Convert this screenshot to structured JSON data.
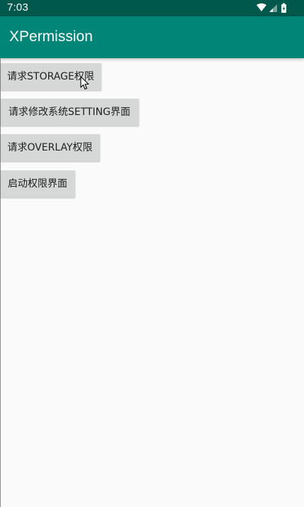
{
  "status_bar": {
    "time": "7:03",
    "icons": [
      "wifi-icon",
      "signal-icon",
      "battery-icon"
    ]
  },
  "app_bar": {
    "title": "XPermission"
  },
  "buttons": [
    {
      "label": "请求STORAGE权限"
    },
    {
      "label": "请求修改系统SETTING界面"
    },
    {
      "label": "请求OVERLAY权限"
    },
    {
      "label": "启动权限界面"
    }
  ],
  "colors": {
    "status_bar": "#00574b",
    "app_bar": "#008577",
    "button_bg": "#d6d7d7",
    "background": "#fafafa"
  }
}
